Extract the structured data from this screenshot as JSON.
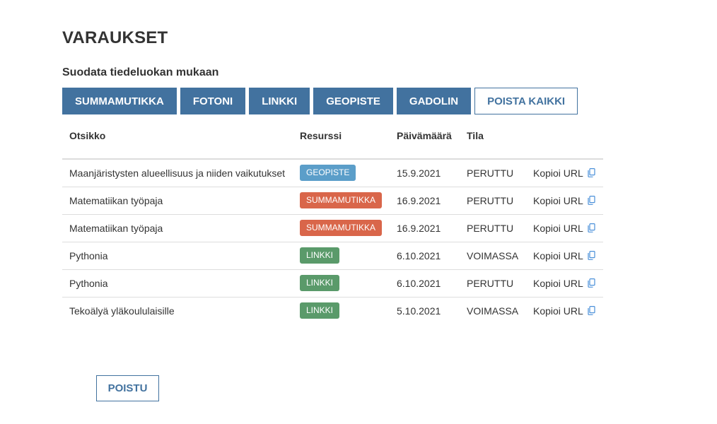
{
  "page": {
    "title": "VARAUKSET",
    "filter_heading": "Suodata tiedeluokan mukaan"
  },
  "filters": [
    {
      "label": "SUMMAMUTIKKA"
    },
    {
      "label": "FOTONI"
    },
    {
      "label": "LINKKI"
    },
    {
      "label": "GEOPISTE"
    },
    {
      "label": "GADOLIN"
    }
  ],
  "clear_filters_label": "POISTA KAIKKI",
  "table": {
    "headers": {
      "title": "Otsikko",
      "resource": "Resurssi",
      "date": "Päivämäärä",
      "status": "Tila"
    },
    "copy_label": "Kopioi URL",
    "rows": [
      {
        "title": "Maanjäristysten alueellisuus ja niiden vaikutukset",
        "resource": "GEOPISTE",
        "resource_color": "#5b9ec9",
        "date": "15.9.2021",
        "status": "PERUTTU"
      },
      {
        "title": "Matematiikan työpaja",
        "resource": "SUMMAMUTIKKA",
        "resource_color": "#d9664a",
        "date": "16.9.2021",
        "status": "PERUTTU"
      },
      {
        "title": "Matematiikan työpaja",
        "resource": "SUMMAMUTIKKA",
        "resource_color": "#d9664a",
        "date": "16.9.2021",
        "status": "PERUTTU"
      },
      {
        "title": "Pythonia",
        "resource": "LINKKI",
        "resource_color": "#5a9a6a",
        "date": "6.10.2021",
        "status": "VOIMASSA"
      },
      {
        "title": "Pythonia",
        "resource": "LINKKI",
        "resource_color": "#5a9a6a",
        "date": "6.10.2021",
        "status": "PERUTTU"
      },
      {
        "title": "Tekoälyä yläkoululaisille",
        "resource": "LINKKI",
        "resource_color": "#5a9a6a",
        "date": "5.10.2021",
        "status": "VOIMASSA"
      }
    ]
  },
  "exit_label": "POISTU",
  "colors": {
    "primary": "#42729f",
    "copy_icon": "#4a90d9"
  }
}
